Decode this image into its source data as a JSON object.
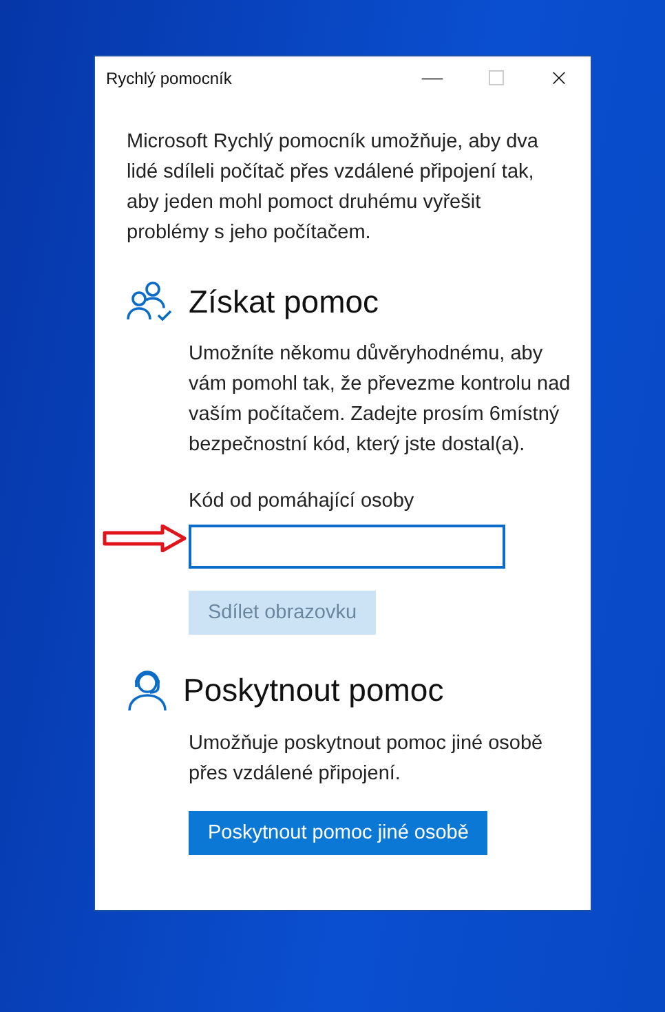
{
  "window": {
    "title": "Rychlý pomocník",
    "controls": [
      "—",
      "×"
    ]
  },
  "intro": "Microsoft Rychlý pomocník umožňuje, aby dva lidé sdíleli počítač přes vzdálené připojení tak, aby jeden mohl pomoct druhému vyřešit problémy s jeho počítačem.",
  "sections": [
    {
      "kind": "get",
      "heading": "Získat pomoc",
      "text": "Umožníte někomu důvěryhodnému, aby vám pomohl tak, že převezme kontrolu nad vaším počítačem. Zadejte prosím 6místný bezpečnostní kód, který jste dostal(a).",
      "field": {
        "label": "Kód od pomáhající osoby"
      },
      "button": {
        "label": "Sdílet obrazovku",
        "disabled": true
      }
    },
    {
      "kind": "give",
      "heading": "Poskytnout pomoc",
      "text": "Umožňuje poskytnout pomoc jiné osobě přes vzdálené připojení.",
      "button": {
        "label": "Poskytnout pomoc jiné osobě",
        "disabled": false
      }
    }
  ]
}
